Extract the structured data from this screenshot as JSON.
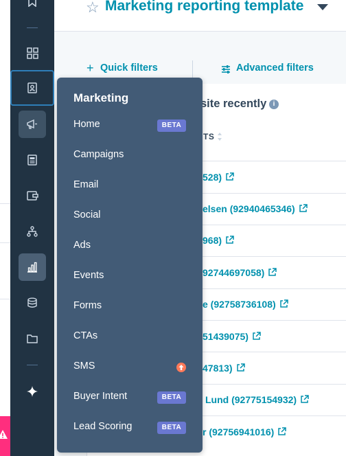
{
  "header": {
    "title": "Marketing reporting template"
  },
  "filters": {
    "quick": "Quick filters",
    "advanced": "Advanced filters"
  },
  "panel": {
    "title": "site recently",
    "column": "TS",
    "rows": [
      "528)",
      "elsen (92940465346)",
      "968)",
      "92744697058)",
      "e (92758736108)",
      "51439075)",
      "47813)",
      "Lund (92775154932)",
      "r (92756941016)"
    ]
  },
  "menu": {
    "heading": "Marketing",
    "badge": "BETA",
    "items": [
      {
        "label": "Home",
        "badge": "BETA"
      },
      {
        "label": "Campaigns"
      },
      {
        "label": "Email"
      },
      {
        "label": "Social"
      },
      {
        "label": "Ads"
      },
      {
        "label": "Events"
      },
      {
        "label": "Forms"
      },
      {
        "label": "CTAs"
      },
      {
        "label": "SMS",
        "indicator": "upgrade-icon"
      },
      {
        "label": "Buyer Intent",
        "badge": "BETA"
      },
      {
        "label": "Lead Scoring",
        "badge": "BETA"
      }
    ]
  },
  "rail": {
    "icons": [
      "bookmark-icon",
      "grid-icon",
      "contacts-icon",
      "megaphone-icon",
      "content-icon",
      "commerce-icon",
      "automation-icon",
      "reporting-icon",
      "data-icon",
      "library-icon",
      "ai-sparkle-icon"
    ]
  },
  "colors": {
    "rail": "#213343",
    "menu": "#425b76",
    "link": "#0091ae",
    "beta": "#6a78d1",
    "upgrade": "#ff7a59",
    "alert": "#ff2e7e"
  }
}
